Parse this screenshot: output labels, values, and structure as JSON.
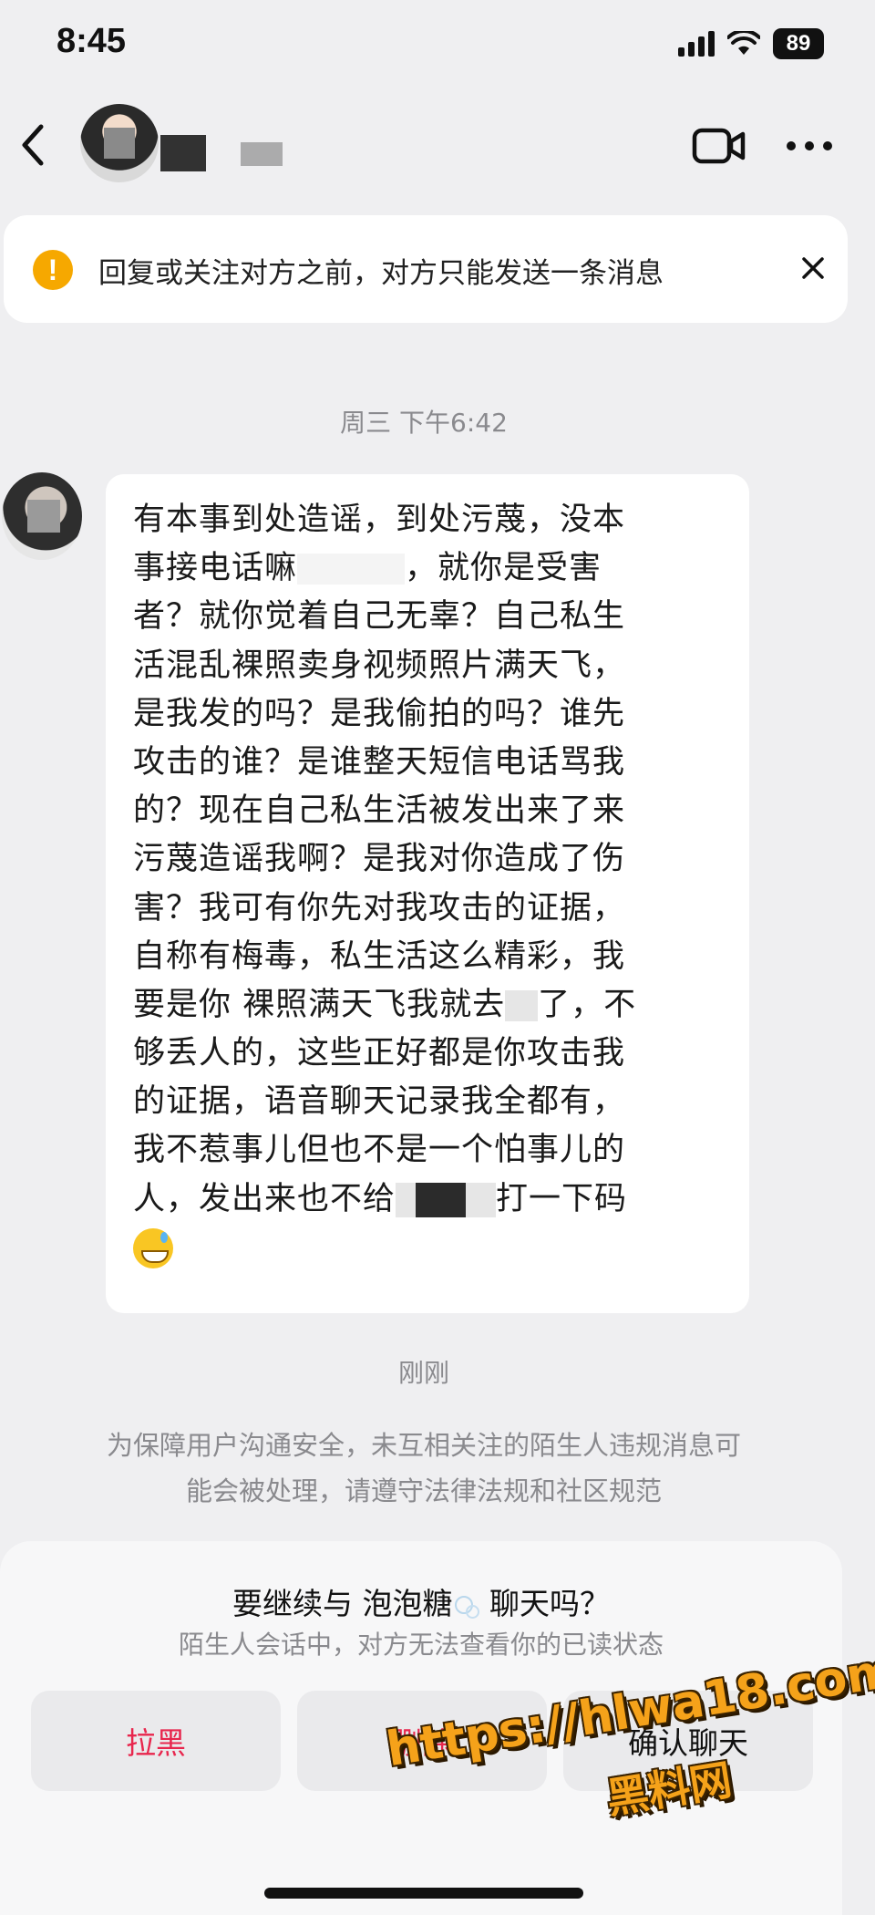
{
  "status_bar": {
    "time": "8:45",
    "battery": "89"
  },
  "header": {
    "contact_name": ""
  },
  "notice": {
    "text": "回复或关注对方之前，对方只能发送一条消息"
  },
  "conversation": {
    "timestamp": "周三 下午6:42",
    "message_lines": [
      "有本事到处造谣，到处污蔑，没本",
      "事接电话嘛",
      "，就你是受害",
      "者？就你觉着自己无辜？自己私生",
      "活混乱裸照卖身视频照片满天飞，",
      "是我发的吗？是我偷拍的吗？谁先",
      "攻击的谁？是谁整天短信电话骂我",
      "的？现在自己私生活被发出来了来",
      "污蔑造谣我啊？是我对你造成了伤",
      "害？我可有你先对我攻击的证据，",
      "自称有梅毒，私生活这么精彩，我",
      "要是你 裸照满天飞我就去",
      "了，不",
      "够丢人的，这些正好都是你攻击我",
      "的证据，语音聊天记录我全都有，",
      "我不惹事儿但也不是一个怕事儿的",
      "人，发出来也不给",
      "打一下码"
    ],
    "emoji": "grinning-sweat-face",
    "recent_timestamp": "刚刚",
    "safety_lines": [
      "为保障用户沟通安全，未互相关注的陌生人违规消息可",
      "能会被处理，请遵守法律法规和社区规范"
    ]
  },
  "bottom_sheet": {
    "title_prefix": "要继续与 泡泡糖",
    "title_suffix": " 聊天吗？",
    "subtitle": "陌生人会话中，对方无法查看你的已读状态",
    "block_label": "拉黑",
    "delete_label": "删除",
    "confirm_label": "确认聊天",
    "danger_color": "#e8264d"
  },
  "watermark": {
    "url": "https://hlwa18.com",
    "name": "黑料网"
  },
  "icons": {
    "back": "chevron-left-icon",
    "video": "video-camera-icon",
    "more": "ellipsis-icon",
    "warning": "warning-icon",
    "close": "close-icon"
  }
}
